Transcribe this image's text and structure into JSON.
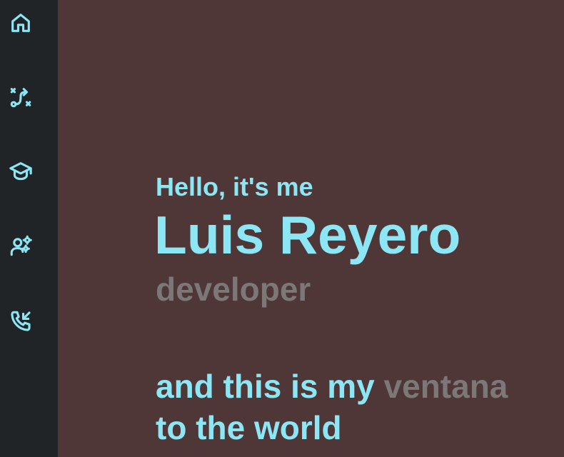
{
  "sidebar": {
    "items": [
      {
        "icon": "home-icon",
        "label": "Home"
      },
      {
        "icon": "route-icon",
        "label": "Path"
      },
      {
        "icon": "graduation-cap-icon",
        "label": "Education"
      },
      {
        "icon": "user-gears-icon",
        "label": "Skills"
      },
      {
        "icon": "phone-incoming-icon",
        "label": "Contact"
      }
    ]
  },
  "hero": {
    "greeting": "Hello, it's me",
    "name": "Luis Reyero",
    "role": "developer",
    "tagline_part1": "and this is my ",
    "tagline_accent": "ventana",
    "tagline_part2": "to the world"
  },
  "colors": {
    "background": "#4f3637",
    "sidebar": "#212427",
    "accent": "#8ce6f4",
    "muted": "#7d7878"
  }
}
